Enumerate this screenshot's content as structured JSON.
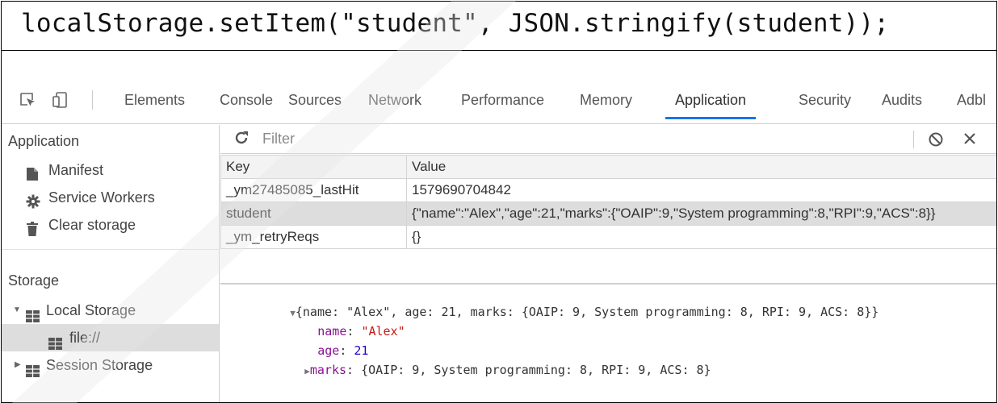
{
  "code": {
    "line": "localStorage.setItem(\"student\", JSON.stringify(student));"
  },
  "devtools": {
    "tabs": [
      {
        "label": "Elements"
      },
      {
        "label": "Console"
      },
      {
        "label": "Sources"
      },
      {
        "label": "Network"
      },
      {
        "label": "Performance"
      },
      {
        "label": "Memory"
      },
      {
        "label": "Application",
        "active": true
      },
      {
        "label": "Security"
      },
      {
        "label": "Audits"
      },
      {
        "label": "Adbl"
      }
    ],
    "active_tab_color": "#1a73e8"
  },
  "sidebar": {
    "application_header": "Application",
    "items": [
      {
        "label": "Manifest",
        "icon": "document-icon"
      },
      {
        "label": "Service Workers",
        "icon": "gear-icon"
      },
      {
        "label": "Clear storage",
        "icon": "trash-icon"
      }
    ],
    "storage_header": "Storage",
    "local_storage": {
      "label": "Local Storage",
      "icon": "grid-icon",
      "child": "file://"
    },
    "session_storage": {
      "label": "Session Storage",
      "icon": "grid-icon"
    }
  },
  "filter": {
    "placeholder": "Filter"
  },
  "table": {
    "headers": {
      "key": "Key",
      "value": "Value"
    },
    "rows": [
      {
        "key": "_ym27485085_lastHit",
        "value": "1579690704842"
      },
      {
        "key": "student",
        "value": "{\"name\":\"Alex\",\"age\":21,\"marks\":{\"OAIP\":9,\"System programming\":8,\"RPI\":9,\"ACS\":8}}",
        "selected": true
      },
      {
        "key": "_ym_retryReqs",
        "value": "{}"
      }
    ]
  },
  "preview": {
    "summary": "{name: \"Alex\", age: 21, marks: {OAIP: 9, System programming: 8, RPI: 9, ACS: 8}}",
    "name_key": "name",
    "name_value": "\"Alex\"",
    "age_key": "age",
    "age_value": "21",
    "marks_key": "marks",
    "marks_value": "{OAIP: 9, System programming: 8, RPI: 9, ACS: 8}"
  }
}
